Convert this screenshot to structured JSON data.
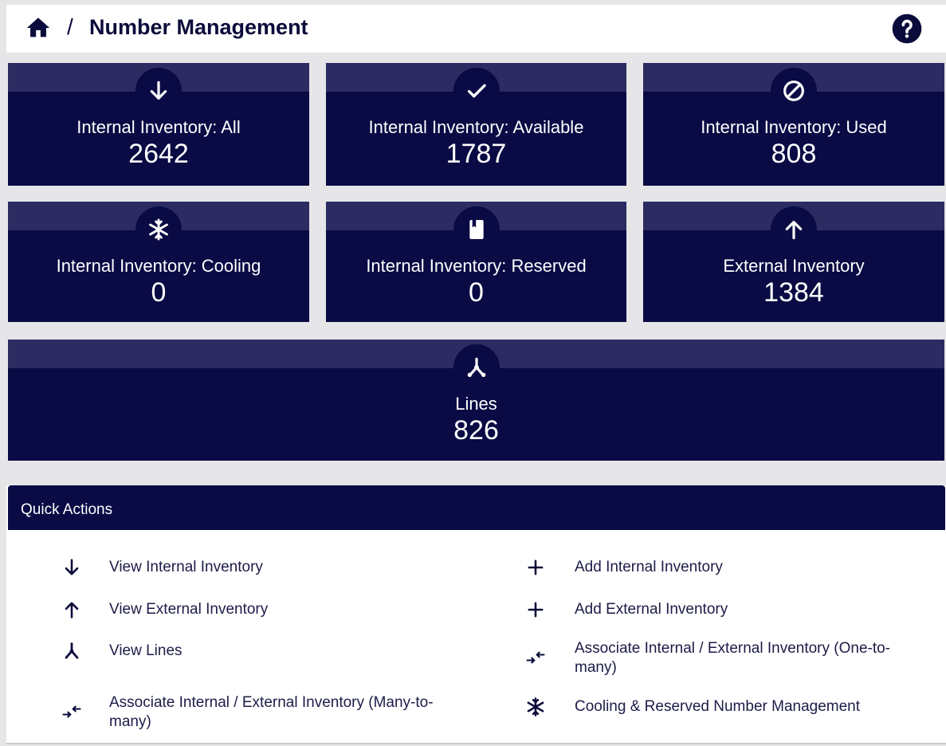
{
  "header": {
    "title": "Number Management",
    "separator": "/",
    "home_icon": "home-icon",
    "help_icon": "help-icon"
  },
  "cards": [
    {
      "label": "Internal Inventory: All",
      "value": "2642",
      "icon": "arrow-down-icon"
    },
    {
      "label": "Internal Inventory: Available",
      "value": "1787",
      "icon": "check-icon"
    },
    {
      "label": "Internal Inventory: Used",
      "value": "808",
      "icon": "block-icon"
    },
    {
      "label": "Internal Inventory: Cooling",
      "value": "0",
      "icon": "snowflake-icon"
    },
    {
      "label": "Internal Inventory: Reserved",
      "value": "0",
      "icon": "bookmark-icon"
    },
    {
      "label": "External Inventory",
      "value": "1384",
      "icon": "arrow-up-icon"
    },
    {
      "label": "Lines",
      "value": "826",
      "icon": "lines-merge-icon"
    }
  ],
  "quick_actions": {
    "title": "Quick Actions",
    "left": [
      {
        "label": "View Internal Inventory",
        "icon": "arrow-down-icon"
      },
      {
        "label": "View External Inventory",
        "icon": "arrow-up-icon"
      },
      {
        "label": "View Lines",
        "icon": "lines-merge-icon"
      },
      {
        "label": "Associate Internal / External Inventory (Many-to-many)",
        "icon": "associate-icon"
      }
    ],
    "right": [
      {
        "label": "Add Internal Inventory",
        "icon": "plus-icon"
      },
      {
        "label": "Add External Inventory",
        "icon": "plus-icon"
      },
      {
        "label": "Associate Internal / External Inventory (One-to-many)",
        "icon": "associate-icon"
      },
      {
        "label": "Cooling & Reserved Number Management",
        "icon": "snowflake-icon"
      }
    ]
  },
  "colors": {
    "card_bg": "#0a0a45",
    "card_strip": "#2c2c62",
    "text_dark": "#0b0b3b",
    "band_bg": "#e6e6e8"
  }
}
